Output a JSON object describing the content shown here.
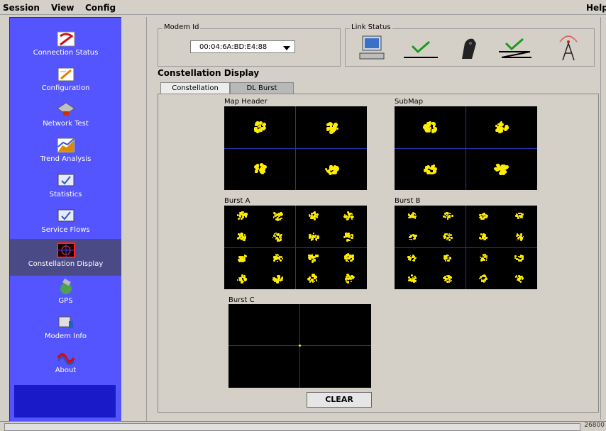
{
  "menu": {
    "session": "Session",
    "view": "View",
    "config": "Config",
    "help": "Help"
  },
  "sidebar": {
    "items": [
      {
        "label": "Connection Status",
        "icon": "connection-status-icon"
      },
      {
        "label": "Configuration",
        "icon": "configuration-icon"
      },
      {
        "label": "Network Test",
        "icon": "network-test-icon"
      },
      {
        "label": "Trend Analysis",
        "icon": "trend-analysis-icon"
      },
      {
        "label": "Statistics",
        "icon": "statistics-icon"
      },
      {
        "label": "Service Flows",
        "icon": "service-flows-icon"
      },
      {
        "label": "Constellation Display",
        "icon": "constellation-display-icon"
      },
      {
        "label": "GPS",
        "icon": "gps-icon"
      },
      {
        "label": "Modem Info",
        "icon": "modem-info-icon"
      },
      {
        "label": "About",
        "icon": "about-icon"
      }
    ]
  },
  "modem": {
    "legend": "Modem Id",
    "selected": "00:04:6A:BD:E4:88"
  },
  "link_status": {
    "legend": "Link Status"
  },
  "panel": {
    "title": "Constellation Display"
  },
  "tabs": [
    {
      "label": "Constellation",
      "active": true
    },
    {
      "label": "DL Burst",
      "active": false
    }
  ],
  "plots": {
    "map_header": "Map Header",
    "submap": "SubMap",
    "burst_a": "Burst A",
    "burst_b": "Burst B",
    "burst_c": "Burst C"
  },
  "clear_button": "CLEAR",
  "status": {
    "number": "26800"
  },
  "colors": {
    "sidebar": "#5555ff",
    "point": "#ffee00",
    "plot_bg": "#000000",
    "axis": "#2233aa"
  }
}
